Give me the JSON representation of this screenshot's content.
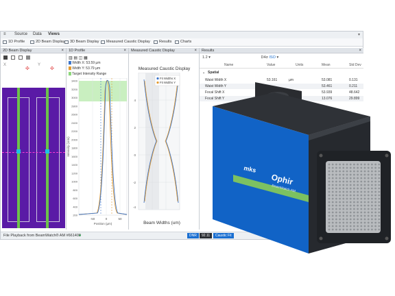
{
  "menu": {
    "source": "Source",
    "data": "Data",
    "views": "Views"
  },
  "toolbar": [
    {
      "label": "1D Profile"
    },
    {
      "label": "2D Beam Display"
    },
    {
      "label": "3D Beam Display"
    },
    {
      "label": "Measured Caustic Display"
    },
    {
      "label": "Results"
    },
    {
      "label": "Charts"
    }
  ],
  "panes": {
    "beam2d": {
      "title": "2D Beam Display",
      "axis_x": "X",
      "axis_y": "Y"
    },
    "profile1d": {
      "title": "1D Profile",
      "width_x": "Width X: 53.59 µm",
      "width_y": "Width Y: 53.79 µm",
      "target": "Target Intensity Range",
      "ylabel": "Intensity (cnts)",
      "xlabel": "Position (µm)",
      "yticks": [
        "3400",
        "3200",
        "3000",
        "2800",
        "2600",
        "2400",
        "2200",
        "2000",
        "1800",
        "1600",
        "1400",
        "1200",
        "1000",
        "800",
        "600",
        "400",
        "200"
      ],
      "xticks": [
        "-50",
        "0",
        "50"
      ]
    },
    "caustic": {
      "title": "Measured Caustic Display",
      "chart_title": "Measured Caustic Display",
      "legend_x": "Fit Widths X",
      "legend_y": "Fit Widths Y",
      "xlabel": "Beam Widths (um)",
      "yticks": [
        "4",
        "2",
        "0",
        "-2",
        "-4"
      ]
    },
    "results": {
      "title": "Results",
      "dropdown": "D4σ",
      "iso": "ISO",
      "columns": [
        "Name",
        "Value",
        "Units",
        "Mean",
        "Std Dev"
      ],
      "section": "Spatial",
      "rows": [
        {
          "name": "Waist Width X",
          "value": "53.161",
          "units": "µm",
          "mean": "53.081",
          "std": "0.131"
        },
        {
          "name": "Waist Width Y",
          "value": "53.5??",
          "units": "",
          "mean": "53.461",
          "std": "0.211"
        },
        {
          "name": "Focal Shift X",
          "value": "",
          "units": "",
          "mean": "53.939",
          "std": "48.642"
        },
        {
          "name": "Focal Shift Y",
          "value": "",
          "units": "",
          "mean": "13.076",
          "std": "29.899"
        }
      ]
    }
  },
  "status": {
    "text": "File Playback from BeamWatch® AM #661400",
    "dnr": "DNR",
    "dnr_value": "92.11",
    "extra": "Caustic Fit"
  },
  "device": {
    "brand": "Ophir",
    "model": "BeamWatch AM",
    "maker": "mks"
  },
  "colors": {
    "accent_blue": "#1a6fd1",
    "device_blue": "#1163c6",
    "fit_x": "#3a73c9",
    "fit_y": "#e39a2e",
    "beam_bg": "#5a1aa6",
    "green": "#6cc24a"
  }
}
